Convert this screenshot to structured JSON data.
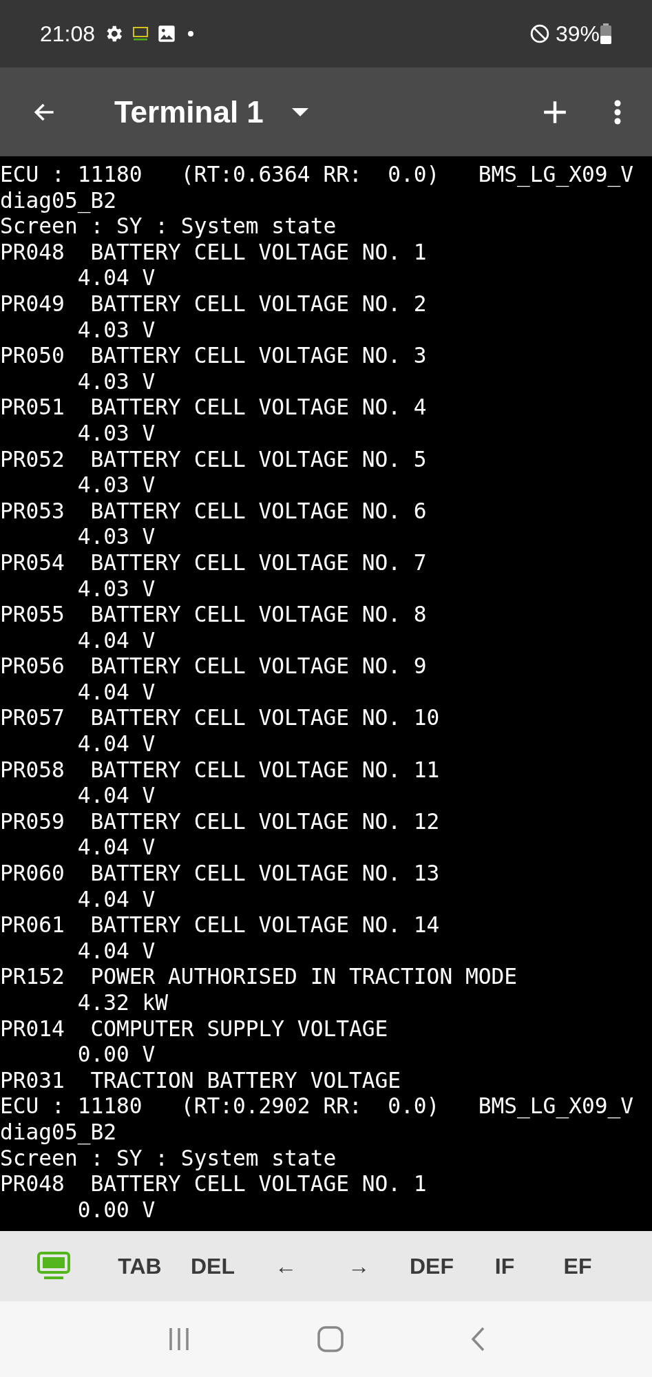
{
  "status_bar": {
    "time": "21:08",
    "battery": "39%"
  },
  "app_bar": {
    "title": "Terminal 1"
  },
  "terminal": {
    "lines": [
      "ECU : 11180   (RT:0.6364 RR:  0.0)   BMS_LG_X09_V",
      "diag05_B2",
      "Screen : SY : System state",
      "PR048  BATTERY CELL VOLTAGE NO. 1",
      "      4.04 V",
      "PR049  BATTERY CELL VOLTAGE NO. 2",
      "      4.03 V",
      "PR050  BATTERY CELL VOLTAGE NO. 3",
      "      4.03 V",
      "PR051  BATTERY CELL VOLTAGE NO. 4",
      "      4.03 V",
      "PR052  BATTERY CELL VOLTAGE NO. 5",
      "      4.03 V",
      "PR053  BATTERY CELL VOLTAGE NO. 6",
      "      4.03 V",
      "PR054  BATTERY CELL VOLTAGE NO. 7",
      "      4.03 V",
      "PR055  BATTERY CELL VOLTAGE NO. 8",
      "      4.04 V",
      "PR056  BATTERY CELL VOLTAGE NO. 9",
      "      4.04 V",
      "PR057  BATTERY CELL VOLTAGE NO. 10",
      "      4.04 V",
      "PR058  BATTERY CELL VOLTAGE NO. 11",
      "      4.04 V",
      "PR059  BATTERY CELL VOLTAGE NO. 12",
      "      4.04 V",
      "PR060  BATTERY CELL VOLTAGE NO. 13",
      "      4.04 V",
      "PR061  BATTERY CELL VOLTAGE NO. 14",
      "      4.04 V",
      "PR152  POWER AUTHORISED IN TRACTION MODE",
      "      4.32 kW",
      "PR014  COMPUTER SUPPLY VOLTAGE",
      "      0.00 V",
      "PR031  TRACTION BATTERY VOLTAGE",
      "ECU : 11180   (RT:0.2902 RR:  0.0)   BMS_LG_X09_V",
      "diag05_B2",
      "Screen : SY : System state",
      "PR048  BATTERY CELL VOLTAGE NO. 1",
      "      0.00 V"
    ]
  },
  "key_bar": {
    "keys": [
      "TAB",
      "DEL",
      "←",
      "→",
      "DEF",
      "IF",
      "EF"
    ]
  }
}
